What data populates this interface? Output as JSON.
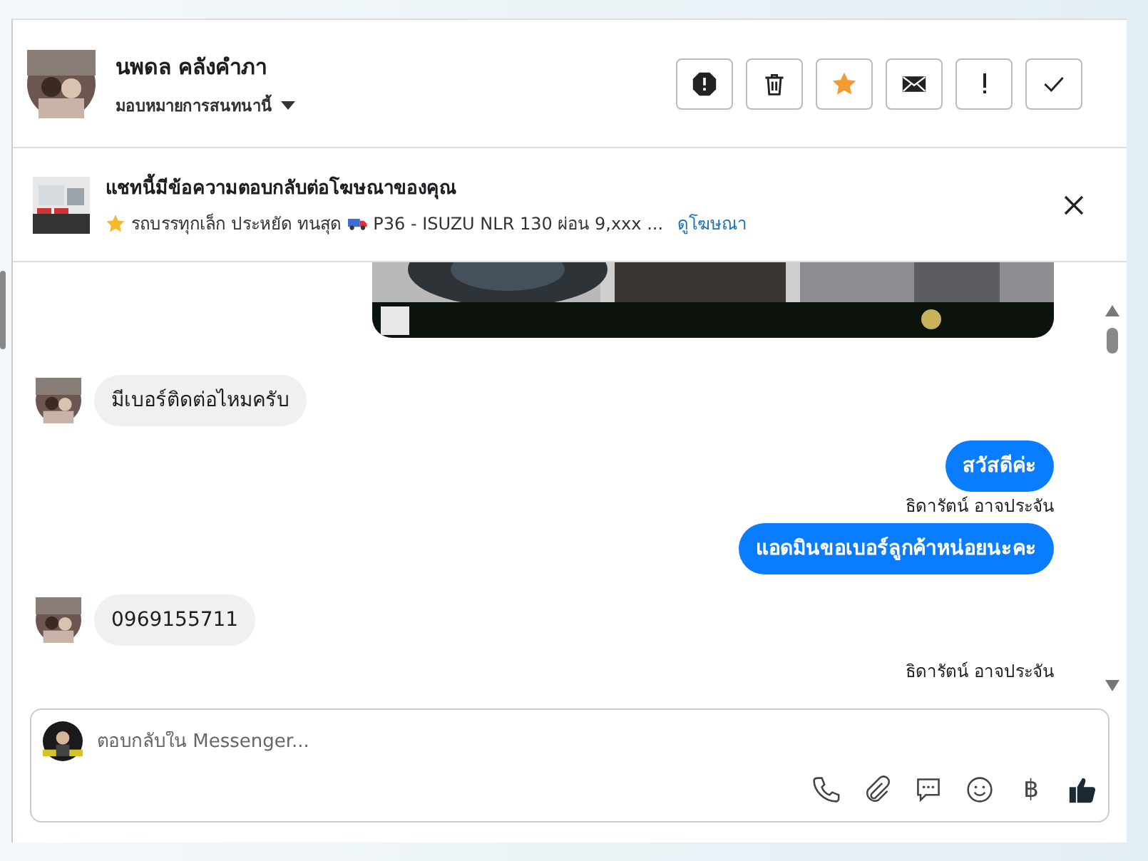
{
  "contact": {
    "name": "นพดล คลังคำภา",
    "assign_label": "มอบหมายการสนทนานี้"
  },
  "actions": [
    {
      "kind": "report",
      "on": false
    },
    {
      "kind": "trash",
      "on": false
    },
    {
      "kind": "star",
      "on": true
    },
    {
      "kind": "mail",
      "on": false
    },
    {
      "kind": "important",
      "on": false
    },
    {
      "kind": "done",
      "on": false
    }
  ],
  "ad": {
    "title": "แชทนี้มีข้อความตอบกลับต่อโฆษณาของคุณ",
    "description": "รถบรรทุกเล็ก ประหยัด ทนสุด",
    "detail": "P36 - ISUZU NLR 130 ผ่อน 9,xxx ...",
    "link": "ดูโฆษณา"
  },
  "messages": [
    {
      "kind": "picture"
    },
    {
      "kind": "incoming",
      "text": "มีเบอร์ติดต่อไหมครับ"
    },
    {
      "kind": "outgoing",
      "text": "สวัสดีค่ะ"
    },
    {
      "kind": "sender",
      "text": "ธิดารัตน์ อาจประจัน"
    },
    {
      "kind": "outgoing",
      "text": "แอดมินขอเบอร์ลูกค้าหน่อยนะคะ"
    },
    {
      "kind": "incoming",
      "text": "0969155711"
    },
    {
      "kind": "sender",
      "text": "ธิดารัตน์ อาจประจัน"
    }
  ],
  "composer": {
    "placeholder": "ตอบกลับใน Messenger..."
  },
  "tools": [
    {
      "kind": "phone"
    },
    {
      "kind": "attach"
    },
    {
      "kind": "comment"
    },
    {
      "kind": "emoji"
    },
    {
      "kind": "baht",
      "text": "฿"
    },
    {
      "kind": "like"
    }
  ]
}
